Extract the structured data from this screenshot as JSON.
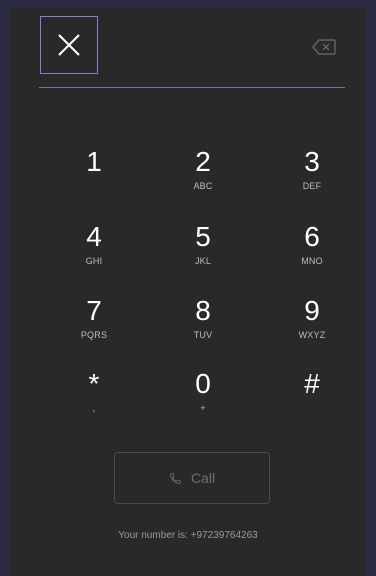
{
  "dialpad": {
    "close_icon": "close-icon",
    "backspace_icon": "backspace-icon",
    "keys": [
      {
        "digit": "1",
        "letters": ""
      },
      {
        "digit": "2",
        "letters": "ABC"
      },
      {
        "digit": "3",
        "letters": "DEF"
      },
      {
        "digit": "4",
        "letters": "GHI"
      },
      {
        "digit": "5",
        "letters": "JKL"
      },
      {
        "digit": "6",
        "letters": "MNO"
      },
      {
        "digit": "7",
        "letters": "PQRS"
      },
      {
        "digit": "8",
        "letters": "TUV"
      },
      {
        "digit": "9",
        "letters": "WXYZ"
      },
      {
        "digit": "*",
        "letters": ","
      },
      {
        "digit": "0",
        "letters": "+"
      },
      {
        "digit": "#",
        "letters": ""
      }
    ]
  },
  "call_button": {
    "label": "Call",
    "icon": "phone-icon"
  },
  "footer": {
    "your_number": "Your number is: +97239764263"
  },
  "colors": {
    "background": "#2b2c44",
    "panel": "#292929",
    "focus_border": "#7b83d8",
    "divider": "#6e73a7"
  }
}
